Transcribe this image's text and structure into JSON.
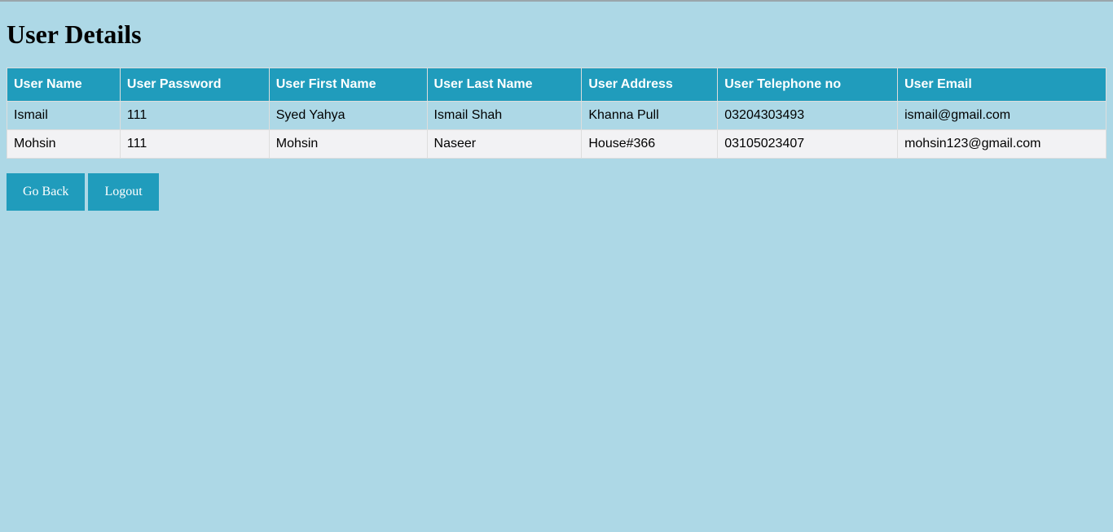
{
  "page": {
    "title": "User Details"
  },
  "table": {
    "headers": [
      "User Name",
      "User Password",
      "User First Name",
      "User Last Name",
      "User Address",
      "User Telephone no",
      "User Email"
    ],
    "rows": [
      [
        "Ismail",
        "111",
        "Syed Yahya",
        "Ismail Shah",
        "Khanna Pull",
        "03204303493",
        "ismail@gmail.com"
      ],
      [
        "Mohsin",
        "111",
        "Mohsin",
        "Naseer",
        "House#366",
        "03105023407",
        "mohsin123@gmail.com"
      ]
    ]
  },
  "actions": {
    "go_back_label": "Go Back",
    "logout_label": "Logout"
  },
  "colors": {
    "background": "#add8e6",
    "accent": "#209cbc",
    "row_alt": "#f2f2f4"
  }
}
